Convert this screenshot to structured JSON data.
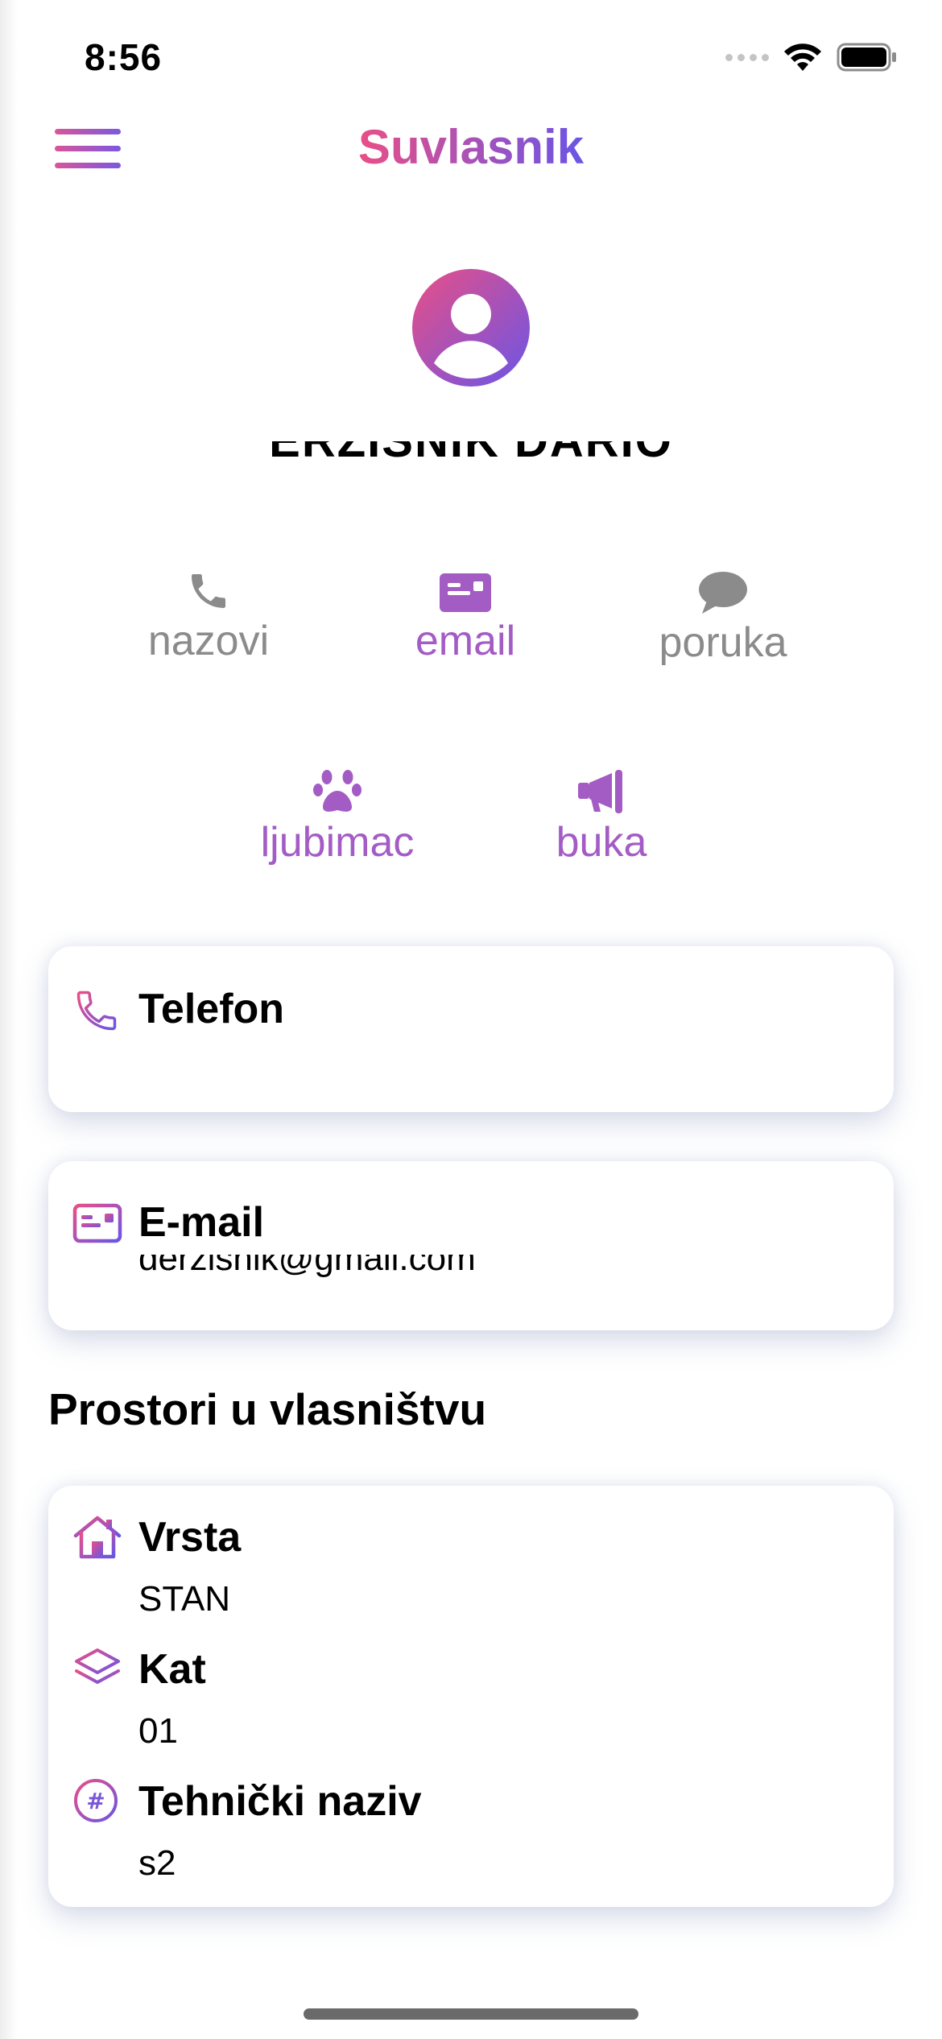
{
  "status_bar": {
    "time": "8:56"
  },
  "header": {
    "title": "Suvlasnik"
  },
  "profile": {
    "name": "ERZISNIK DARIO"
  },
  "actions": [
    {
      "label": "nazovi",
      "icon": "phone-icon"
    },
    {
      "label": "email",
      "icon": "mail-card-icon"
    },
    {
      "label": "poruka",
      "icon": "chat-bubble-icon"
    },
    {
      "label": "ljubimac",
      "icon": "paw-icon"
    },
    {
      "label": "buka",
      "icon": "megaphone-icon"
    }
  ],
  "contact": {
    "phone": {
      "title": "Telefon",
      "value": ""
    },
    "email": {
      "title": "E-mail",
      "value": "derzisnik@gmail.com"
    }
  },
  "ownership": {
    "heading": "Prostori u vlasništvu",
    "rows": [
      {
        "title": "Vrsta",
        "value": "STAN",
        "icon": "house-icon"
      },
      {
        "title": "Kat",
        "value": "01",
        "icon": "layers-icon"
      },
      {
        "title": "Tehnički naziv",
        "value": "s2",
        "icon": "hash-icon"
      }
    ]
  },
  "colors": {
    "gradient_start": "#e94f86",
    "gradient_end": "#6a55e6",
    "active_purple": "#a45cc5",
    "inactive_gray": "#8b8b8b"
  }
}
